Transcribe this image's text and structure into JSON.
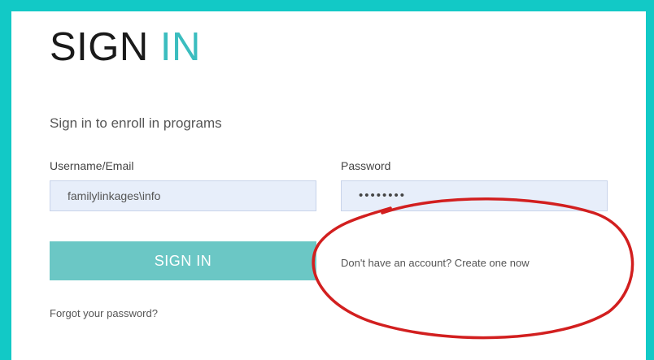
{
  "page": {
    "title_main": "SIGN",
    "title_accent": "IN",
    "subtitle": "Sign in to enroll in programs"
  },
  "form": {
    "username_label": "Username/Email",
    "username_value": "familylinkages\\info",
    "password_label": "Password",
    "password_value": "••••••••",
    "signin_button_label": "SIGN IN",
    "create_account_text": "Don't have an account? Create one now",
    "forgot_password_text": "Forgot your password?"
  },
  "colors": {
    "frame": "#12c9c6",
    "accent": "#3bbdbf",
    "button": "#6bc7c5",
    "input_bg": "#e7eefa",
    "annotation": "#d21f1f"
  }
}
